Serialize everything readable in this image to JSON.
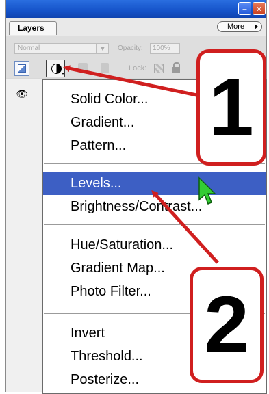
{
  "panel": {
    "tab_label": "Layers",
    "more_label": "More",
    "blend_mode": "Normal",
    "opacity_label": "Opacity:",
    "opacity_value": "100%",
    "lock_label": "Lock:"
  },
  "menu": {
    "groups": [
      [
        "Solid Color...",
        "Gradient...",
        "Pattern..."
      ],
      [
        "Levels...",
        "Brightness/Contrast..."
      ],
      [
        "Hue/Saturation...",
        "Gradient Map...",
        "Photo Filter..."
      ],
      [
        "Invert",
        "Threshold...",
        "Posterize..."
      ]
    ],
    "highlighted": "Levels..."
  },
  "callouts": {
    "one": "1",
    "two": "2"
  },
  "colors": {
    "highlight": "#3d5fc4",
    "annotation_red": "#d01f1f",
    "titlebar": "#1553c9"
  }
}
